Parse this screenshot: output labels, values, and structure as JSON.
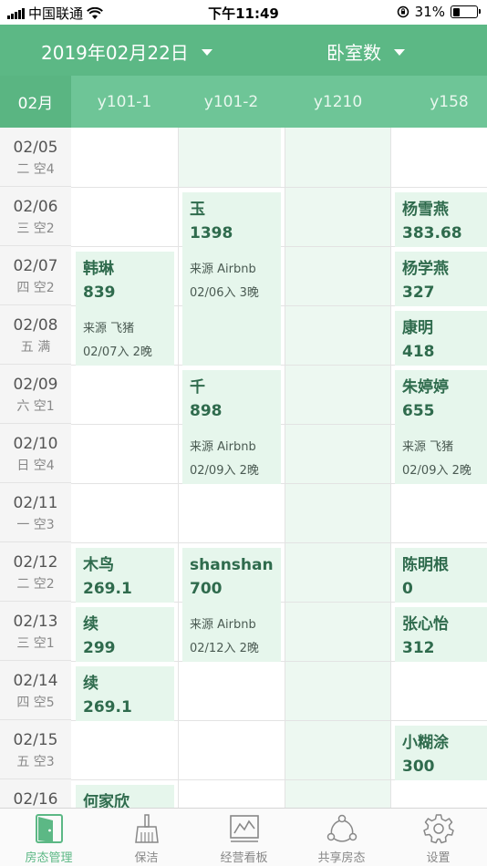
{
  "status_bar": {
    "carrier": "中国联通",
    "time": "下午11:49",
    "battery": "31%",
    "battery_level": 0.31
  },
  "header": {
    "date_selector": "2019年02月22日",
    "room_selector": "卧室数"
  },
  "columns": {
    "month": "02月",
    "rooms": [
      "y101-1",
      "y101-2",
      "y1210",
      "y158"
    ]
  },
  "dates": [
    {
      "date": "02/05",
      "status": "二  空4"
    },
    {
      "date": "02/06",
      "status": "三  空2"
    },
    {
      "date": "02/07",
      "status": "四  空2"
    },
    {
      "date": "02/08",
      "status": "五  满"
    },
    {
      "date": "02/09",
      "status": "六  空1"
    },
    {
      "date": "02/10",
      "status": "日  空4"
    },
    {
      "date": "02/11",
      "status": "一  空3"
    },
    {
      "date": "02/12",
      "status": "二  空2"
    },
    {
      "date": "02/13",
      "status": "三  空1"
    },
    {
      "date": "02/14",
      "status": "四  空5"
    },
    {
      "date": "02/15",
      "status": "五  空3"
    },
    {
      "date": "02/16",
      "status": ""
    }
  ],
  "bookings": [
    {
      "name": "韩琳",
      "price": "839",
      "source": "来源 飞猪",
      "stay": "02/07入 2晚"
    },
    {
      "name": "木鸟",
      "price": "269.1",
      "source": "",
      "stay": ""
    },
    {
      "name": "续",
      "price": "299",
      "source": "",
      "stay": ""
    },
    {
      "name": "续",
      "price": "269.1",
      "source": "",
      "stay": ""
    },
    {
      "name": "何家欣",
      "price": "",
      "source": "",
      "stay": ""
    },
    {
      "name": "玉",
      "price": "1398",
      "source": "来源 Airbnb",
      "stay": "02/06入 3晚"
    },
    {
      "name": "千",
      "price": "898",
      "source": "来源 Airbnb",
      "stay": "02/09入 2晚"
    },
    {
      "name": "shanshan",
      "price": "700",
      "source": "来源 Airbnb",
      "stay": "02/12入 2晚"
    },
    {
      "name": "杨雪燕",
      "price": "383.68",
      "source": "",
      "stay": ""
    },
    {
      "name": "杨学燕",
      "price": "327",
      "source": "",
      "stay": ""
    },
    {
      "name": "康明",
      "price": "418",
      "source": "",
      "stay": ""
    },
    {
      "name": "朱婷婷",
      "price": "655",
      "source": "来源 飞猪",
      "stay": "02/09入 2晚"
    },
    {
      "name": "陈明根",
      "price": "0",
      "source": "",
      "stay": ""
    },
    {
      "name": "张心怡",
      "price": "312",
      "source": "",
      "stay": ""
    },
    {
      "name": "小糊涂",
      "price": "300",
      "source": "",
      "stay": ""
    }
  ],
  "tabs": [
    {
      "label": "房态管理",
      "icon": "door-icon",
      "active": true
    },
    {
      "label": "保洁",
      "icon": "broom-icon",
      "active": false
    },
    {
      "label": "经营看板",
      "icon": "chart-board-icon",
      "active": false
    },
    {
      "label": "共享房态",
      "icon": "share-icon",
      "active": false
    },
    {
      "label": "设置",
      "icon": "gear-icon",
      "active": false
    }
  ],
  "colors": {
    "primary": "#5cb885",
    "booking_bg": "#e6f6ec",
    "booking_text": "#2f6b4d",
    "tab_inactive": "#888888"
  }
}
